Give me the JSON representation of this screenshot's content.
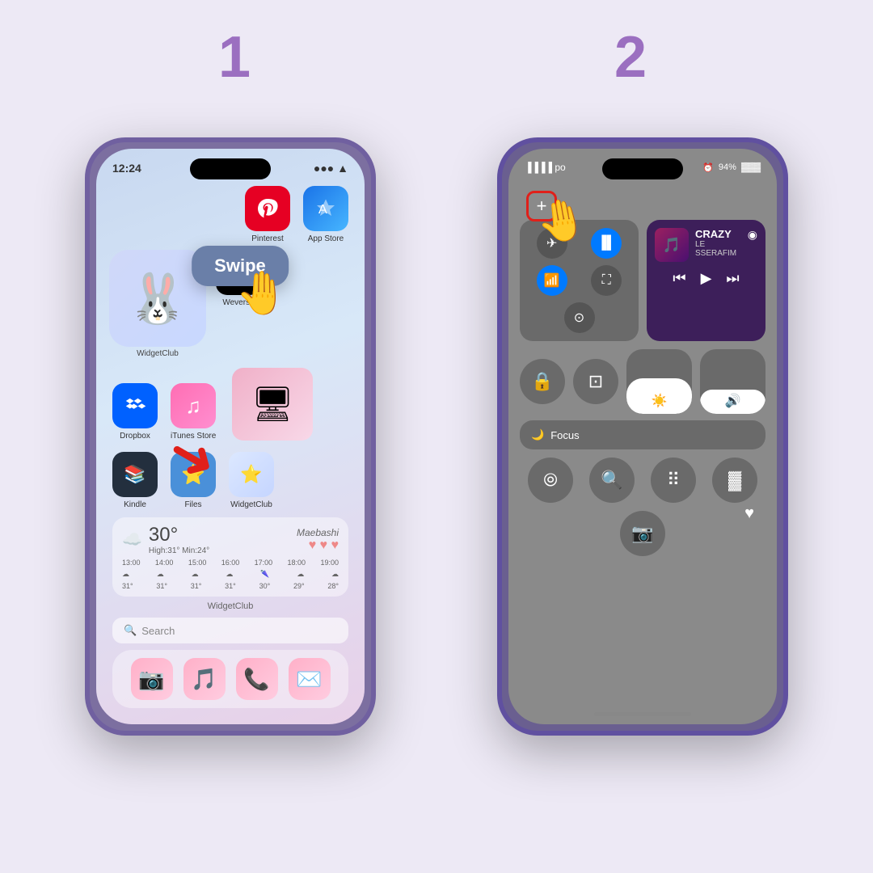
{
  "page": {
    "background": "#ede9f5",
    "step1_number": "1",
    "step2_number": "2"
  },
  "phone1": {
    "time": "12:24",
    "swipe_label": "Swipe",
    "apps_row1": [
      {
        "name": "Pinterest",
        "label": "Pinterest",
        "emoji": "📌"
      },
      {
        "name": "App Store",
        "label": "App Store",
        "emoji": "🅰"
      }
    ],
    "widget_label": "WidgetClub",
    "apps_row2_left": {
      "name": "Weverse",
      "label": "w",
      "emoji": "w"
    },
    "apps_row2_right": {
      "name": "Weverse",
      "label": "Weverse"
    },
    "apps_row3": [
      {
        "name": "Dropbox",
        "label": "Dropbox"
      },
      {
        "name": "iTunes Store",
        "label": "iTunes Store"
      },
      {
        "name": "WidgetClub",
        "label": "WidgetClub (computer)"
      }
    ],
    "apps_row4": [
      {
        "name": "Kindle",
        "label": "Kindle"
      },
      {
        "name": "Files",
        "label": "Files"
      },
      {
        "name": "WidgetClub",
        "label": "WidgetClub"
      }
    ],
    "weather": {
      "temp": "30°",
      "high_low": "High:31° Min:24°",
      "location": "Maebashi",
      "times": [
        "13:00",
        "14:00",
        "15:00",
        "16:00",
        "17:00",
        "18:00",
        "19:00"
      ],
      "temps": [
        "31°",
        "31°",
        "31°",
        "31°",
        "30°",
        "29°",
        "28°"
      ]
    },
    "widget_footer": "WidgetClub",
    "search_placeholder": "🔍 Search",
    "dock_icons": [
      "📷",
      "🎵",
      "📞",
      "✉️"
    ]
  },
  "phone2": {
    "signal": "●●●● po",
    "battery": "⏰ ⊙ 94% 🔋",
    "plus_btn": "+",
    "now_playing": {
      "title": "CRAZY",
      "artist": "LE SSERAFIM",
      "emoji": "🎵"
    },
    "connectivity": {
      "airplane": "✈️",
      "wifi": "📶",
      "bluetooth": "⬛",
      "signal_bars": "📊"
    },
    "focus_label": "Focus",
    "brightness_icon": "☀️",
    "volume_icon": "🔊",
    "controls": [
      "🔒",
      "🖥",
      "❤️"
    ],
    "buttons_row": [
      "⦾",
      "🔍",
      "🔢",
      "🔋"
    ],
    "camera_btn": "📷"
  }
}
